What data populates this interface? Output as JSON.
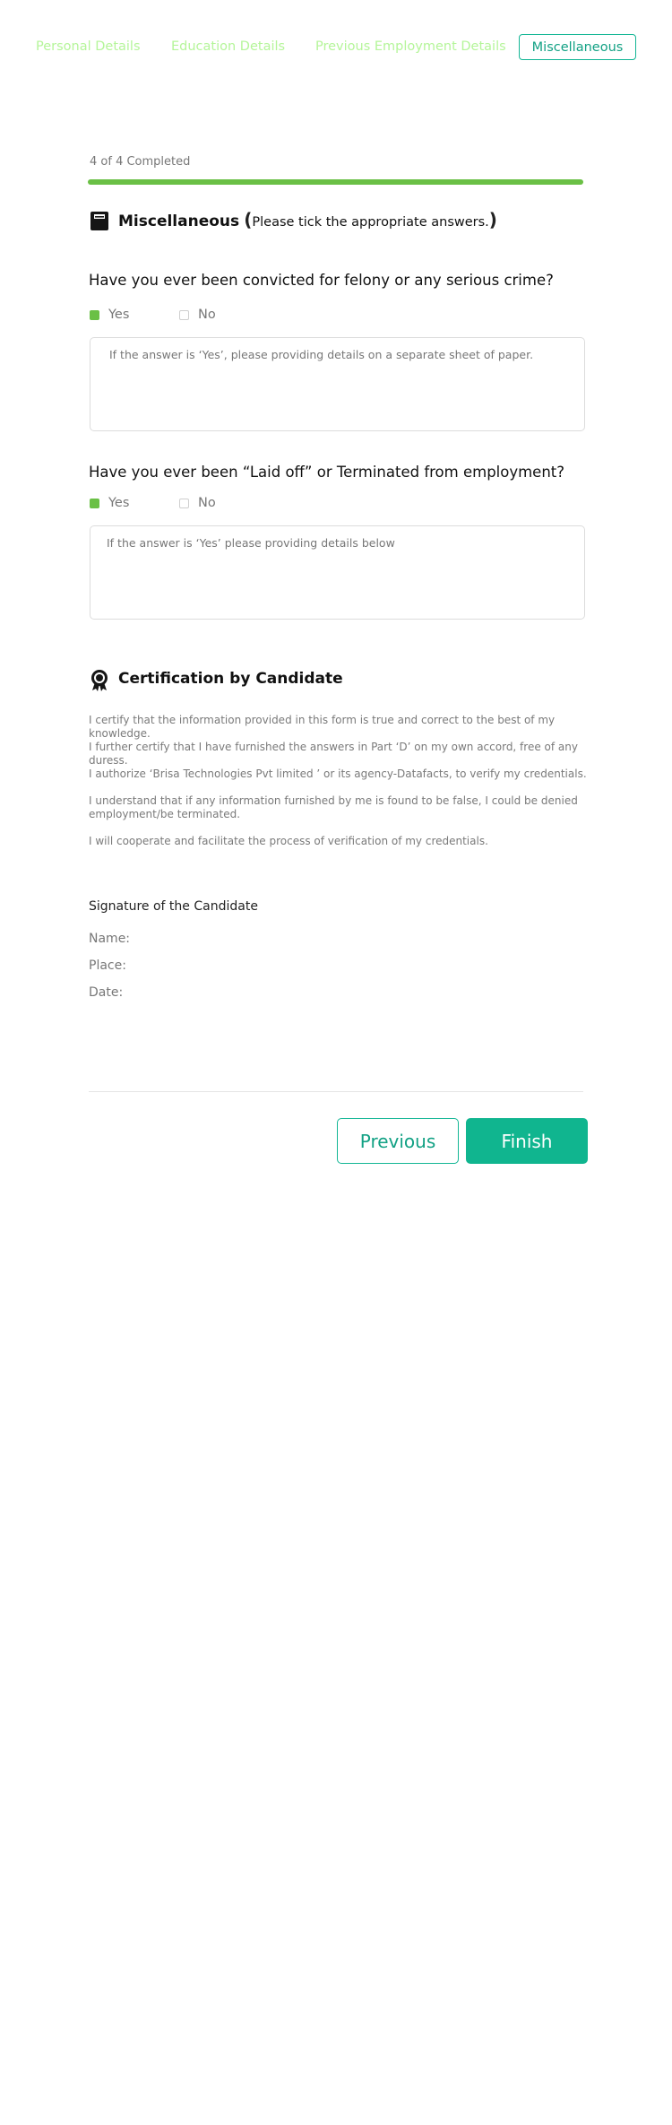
{
  "tabs": [
    {
      "label": "Personal Details"
    },
    {
      "label": "Education Details"
    },
    {
      "label": "Previous Employment Details"
    },
    {
      "label": "Miscellaneous"
    }
  ],
  "progress": {
    "text": "4 of 4 Completed",
    "fraction": 1.0,
    "color": "#6ac045"
  },
  "misc": {
    "title": "Miscellaneous",
    "open_paren": "(",
    "note": "Please tick the appropriate answers.",
    "close_paren": ")",
    "icon": "folder-icon"
  },
  "questions": [
    {
      "text": "Have you ever been convicted for felony or any serious crime?",
      "yes_label": "Yes",
      "no_label": "No",
      "selected": "Yes",
      "details_placeholder": "If the answer is ‘Yes’, please providing details on a separate sheet of paper."
    },
    {
      "text": "Have you ever been “Laid off” or Terminated from employment?",
      "yes_label": "Yes",
      "no_label": "No",
      "selected": "Yes",
      "details_placeholder": "If the answer is ‘Yes’ please providing details below"
    }
  ],
  "certification": {
    "title": "Certification by Candidate",
    "icon": "award-badge-icon",
    "lines": [
      "I certify that the information provided in this form is true and correct to the best of my knowledge.",
      "I further certify that I have furnished the answers in Part ‘D’ on my own accord, free of any duress.",
      "I authorize ‘Brisa Technologies Pvt limited ’ or its agency-Datafacts,  to verify my credentials.",
      "I understand that if any information furnished by me is found to be false, I could be denied employment/be terminated.",
      "I will cooperate and facilitate the process of verification of my credentials."
    ]
  },
  "signature": {
    "title": "Signature of the Candidate",
    "name_label": "Name:",
    "place_label": "Place:",
    "date_label": "Date:"
  },
  "buttons": {
    "previous": "Previous",
    "finish": "Finish"
  },
  "colors": {
    "accent": "#10b58f",
    "check": "#6ac045",
    "tab_inactive": "#b5f59a"
  }
}
